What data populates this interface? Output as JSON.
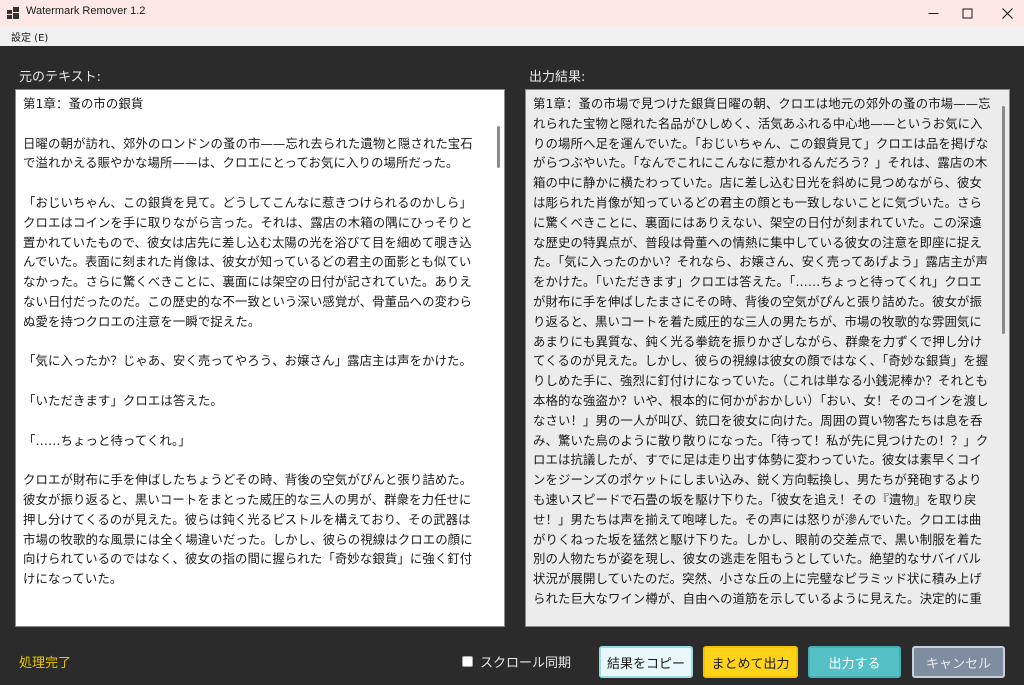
{
  "window": {
    "title": "Watermark Remover 1.2",
    "icons": {
      "app": "app-icon",
      "minimize": "minimize-icon",
      "maximize": "maximize-icon",
      "close": "close-icon"
    }
  },
  "menu": {
    "settings": "設定 (E)"
  },
  "left_panel": {
    "label": "元のテキスト:",
    "text": "第1章：蚤の市の銀貨\n\n日曜の朝が訪れ、郊外のロンドンの蚤の市——忘れ去られた遺物と隠された宝石で溢れかえる賑やかな場所——は、クロエにとってお気に入りの場所だった。\n\n「おじいちゃん、この銀貨を見て。どうしてこんなに惹きつけられるのかしら」クロエはコインを手に取りながら言った。それは、露店の木箱の隅にひっそりと置かれていたもので、彼女は店先に差し込む太陽の光を浴びて目を細めて覗き込んでいた。表面に刻まれた肖像は、彼女が知っているどの君主の面影とも似ていなかった。さらに驚くべきことに、裏面には架空の日付が記されていた。ありえない日付だったのだ。この歴史的な不一致という深い感覚が、骨董品への変わらぬ愛を持つクロエの注意を一瞬で捉えた。\n\n「気に入ったか？じゃあ、安く売ってやろう、お嬢さん」露店主は声をかけた。\n\n「いただきます」クロエは答えた。\n\n「……ちょっと待ってくれ。」\n\nクロエが財布に手を伸ばしたちょうどその時、背後の空気がぴんと張り詰めた。彼女が振り返ると、黒いコートをまとった威圧的な三人の男が、群衆を力任せに押し分けてくるのが見えた。彼らは鈍く光るピストルを構えており、その武器は市場の牧歌的な風景には全く場違いだった。しかし、彼らの視線はクロエの顔に向けられているのではなく、彼女の指の間に握られた「奇妙な銀貨」に強く釘付けになっていた。"
  },
  "right_panel": {
    "label": "出力結果:",
    "text": "第1章：蚤の市場で見つけた銀貨日曜の朝、クロエは地元の郊外の蚤の市場——忘れられた宝物と隠れた名品がひしめく、活気あふれる中心地——というお気に入りの場所へ足を運んでいた。「おじいちゃん、この銀貨見て」クロエは品を掲げながらつぶやいた。「なんでこれにこんなに惹かれるんだろう？」それは、露店の木箱の中に静かに横たわっていた。店に差し込む日光を斜めに見つめながら、彼女は彫られた肖像が知っているどの君主の顔とも一致しないことに気づいた。さらに驚くべきことに、裏面にはありえない、架空の日付が刻まれていた。この深遠な歴史の特異点が、普段は骨董への情熱に集中している彼女の注意を即座に捉えた。「気に入ったのかい？それなら、お嬢さん、安く売ってあげよう」露店主が声をかけた。「いただきます」クロエは答えた。「……ちょっと待ってくれ」クロエが財布に手を伸ばしたまさにその時、背後の空気がぴんと張り詰めた。彼女が振り返ると、黒いコートを着た威圧的な三人の男たちが、市場の牧歌的な雰囲気にあまりにも異質な、鈍く光る拳銃を振りかざしながら、群衆を力ずくで押し分けてくるのが見えた。しかし、彼らの視線は彼女の顔ではなく、「奇妙な銀貨」を握りしめた手に、強烈に釘付けになっていた。（これは単なる小銭泥棒か？それとも本格的な強盗か？いや、根本的に何かがおかしい）「おい、女！そのコインを渡しなさい！」男の一人が叫び、銃口を彼女に向けた。周囲の買い物客たちは息を呑み、驚いた鳥のように散り散りになった。「待って！私が先に見つけたの！？」クロエは抗議したが、すでに足は走り出す体勢に変わっていた。彼女は素早くコインをジーンズのポケットにしまい込み、鋭く方向転換し、男たちが発砲するよりも速いスピードで石畳の坂を駆け下りた。「彼女を追え！その『遺物』を取り戻せ！」男たちは声を揃えて咆哮した。その声には怒りが滲んでいた。クロエは曲がりくねった坂を猛然と駆け下りた。しかし、眼前の交差点で、黒い制服を着た別の人物たちが姿を現し、彼女の逃走を阻もうとしていた。絶望的なサバイバル状況が展開していたのだ。突然、小さな丘の上に完璧なピラミッド状に積み上げられた巨大なワイン樽が、自由への道筋を示しているように見えた。決定的に重"
  },
  "status": "処理完了",
  "scroll_sync": {
    "label": "スクロール同期",
    "checked": false
  },
  "buttons": {
    "copy": "結果をコピー",
    "merge": "まとめて出力",
    "output": "出力する",
    "cancel": "キャンセル"
  },
  "colors": {
    "window_bg": "#2b2b2b",
    "status": "#e8c400",
    "merge_button": "#ffd31a",
    "output_button": "#55c1c6",
    "cancel_button": "#7f8da0"
  }
}
